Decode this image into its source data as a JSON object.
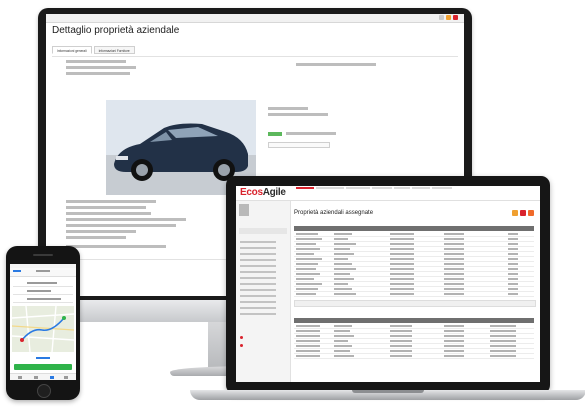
{
  "desktop": {
    "page_title": "Dettaglio proprietà aziendale",
    "tabs": [
      {
        "label": "Informazioni generali"
      },
      {
        "label": "Informazioni Fornitore"
      }
    ]
  },
  "laptop": {
    "logo_part1": "Ecos",
    "logo_part2": "Agile",
    "page_title": "Proprietà aziendali assegnate"
  },
  "colors": {
    "brand_red": "#d9232d",
    "link_blue": "#2d6fb3",
    "phone_button_green": "#2fb34a",
    "device_black": "#1a1a1a"
  }
}
